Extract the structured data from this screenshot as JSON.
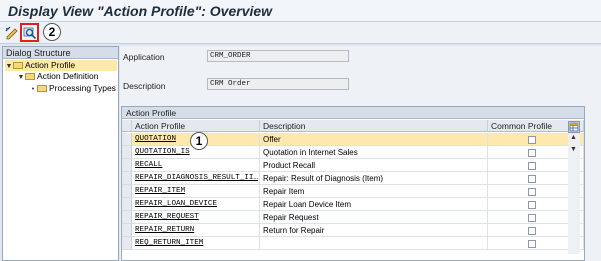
{
  "title": "Display View \"Action Profile\": Overview",
  "toolbar": {
    "icons": [
      "edit-display-toggle-icon",
      "position-search-icon"
    ],
    "callout_2": "2"
  },
  "dialog": {
    "header": "Dialog Structure",
    "tree": [
      {
        "label": "Action Profile",
        "level": 0,
        "selected": true,
        "icon": "folder-icon"
      },
      {
        "label": "Action Definition",
        "level": 1,
        "selected": false,
        "icon": "folder-icon"
      },
      {
        "label": "Processing Types",
        "level": 2,
        "selected": false,
        "icon": "folder-icon"
      }
    ]
  },
  "fields": {
    "application_label": "Application",
    "application_value": "CRM_ORDER",
    "description_label": "Description",
    "description_value": "CRM Order"
  },
  "table": {
    "title": "Action Profile",
    "columns": [
      "Action Profile",
      "Description",
      "Common Profile"
    ],
    "callout_1": "1",
    "rows": [
      {
        "code": "QUOTATION",
        "desc": "Offer",
        "selected": true
      },
      {
        "code": "QUOTATION_IS",
        "desc": "Quotation in Internet Sales",
        "selected": false
      },
      {
        "code": "RECALL",
        "desc": "Product Recall",
        "selected": false
      },
      {
        "code": "REPAIR_DIAGNOSIS_RESULT_II…",
        "desc": "Repair: Result of Diagnosis (Item)",
        "selected": false
      },
      {
        "code": "REPAIR_ITEM",
        "desc": "Repair Item",
        "selected": false
      },
      {
        "code": "REPAIR_LOAN_DEVICE",
        "desc": "Repair Loan Device Item",
        "selected": false
      },
      {
        "code": "REPAIR_REQUEST",
        "desc": "Repair Request",
        "selected": false
      },
      {
        "code": "REPAIR_RETURN",
        "desc": "Return for Repair",
        "selected": false
      },
      {
        "code": "REQ_RETURN_ITEM",
        "desc": "",
        "selected": false
      }
    ]
  },
  "colors": {
    "selected_row": "#fde8ae",
    "callout_border": "#e0201b",
    "header_bg": "#d4dde8"
  }
}
